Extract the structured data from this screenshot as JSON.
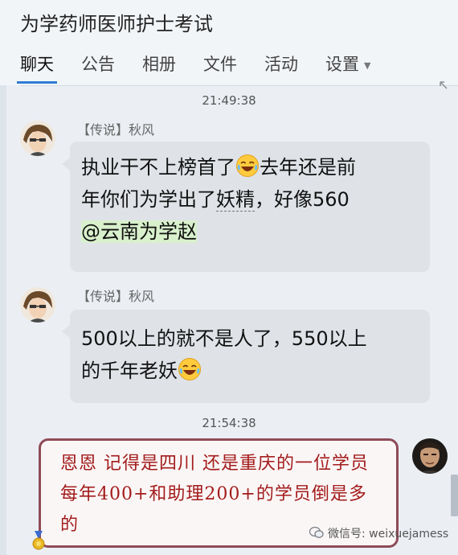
{
  "header": {
    "title": "为学药师医师护士考试",
    "tabs": [
      {
        "label": "聊天",
        "active": true
      },
      {
        "label": "公告"
      },
      {
        "label": "相册"
      },
      {
        "label": "文件"
      },
      {
        "label": "活动"
      },
      {
        "label": "设置"
      }
    ]
  },
  "messages": [
    {
      "time": "21:49:38",
      "sender": "【传说】秋风",
      "lines": [
        "执业干不上榜首了",
        "去年还是前",
        "年你们为学出了",
        "妖精",
        "，好像560",
        "@云南为学赵"
      ]
    },
    {
      "sender": "【传说】秋风",
      "lines": [
        "500以上的就不是人了，550以上",
        "的千年老妖"
      ]
    },
    {
      "time": "21:54:38",
      "text": "恩恩 记得是四川 还是重庆的一位学员 每年400+和助理200+的学员倒是多的"
    }
  ],
  "watermark": "微信号: weixuejamess",
  "colors": {
    "accent": "#2f7cd3",
    "bubble": "#dfe3e8",
    "card_border": "#8e4b57",
    "card_text": "#a31c1c",
    "mention_bg": "#d8f0cc"
  },
  "icons": [
    "laughing-emoji-icon",
    "wechat-icon",
    "medal-icon",
    "avatar-icon",
    "caret-down-icon",
    "collapse-arrow-icon"
  ]
}
